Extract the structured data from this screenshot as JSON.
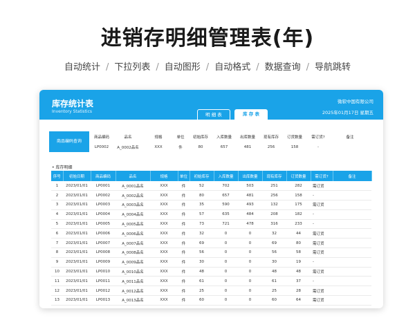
{
  "title": "进销存明细管理表(年)",
  "features": [
    "自动统计",
    "下拉列表",
    "自动图形",
    "自动格式",
    "数据查询",
    "导航跳转"
  ],
  "panel": {
    "title": "库存统计表",
    "subtitle": "Inventory Statistics",
    "company": "微软中国有限公司",
    "date": "2025年01月17日  星期五",
    "tabs": [
      {
        "label": "明 细 表",
        "active": false
      },
      {
        "label": "库 存 表",
        "active": true
      }
    ]
  },
  "query": {
    "button_label": "商品编码查询",
    "headers": [
      "商品编码",
      "品名",
      "规格",
      "单位",
      "初始库存",
      "入库数量",
      "出库数量",
      "现有库存",
      "订货数量",
      "需订货?",
      "备注"
    ],
    "row": [
      "LP0002",
      "A_0002品名",
      "XXX",
      "件",
      "80",
      "657",
      "481",
      "256",
      "158",
      "-",
      ""
    ]
  },
  "section_label": "• 库存明细",
  "table": {
    "headers": [
      "序号",
      "初始日期",
      "商品编码",
      "品名",
      "规格",
      "单位",
      "初始库存",
      "入库数量",
      "出库数量",
      "现有库存",
      "订货数量",
      "需订货?",
      "备注"
    ],
    "rows": [
      [
        "1",
        "2023/01/01",
        "LP0001",
        "A_0001品名",
        "XXX",
        "件",
        "52",
        "702",
        "503",
        "251",
        "282",
        "需订货",
        ""
      ],
      [
        "2",
        "2023/01/01",
        "LP0002",
        "A_0002品名",
        "XXX",
        "件",
        "80",
        "657",
        "481",
        "256",
        "158",
        "-",
        ""
      ],
      [
        "3",
        "2023/01/01",
        "LP0003",
        "A_0003品名",
        "XXX",
        "件",
        "35",
        "590",
        "493",
        "132",
        "175",
        "需订货",
        ""
      ],
      [
        "4",
        "2023/01/01",
        "LP0004",
        "A_0004品名",
        "XXX",
        "件",
        "57",
        "635",
        "484",
        "208",
        "182",
        "-",
        ""
      ],
      [
        "5",
        "2023/01/01",
        "LP0005",
        "A_0005品名",
        "XXX",
        "件",
        "73",
        "721",
        "478",
        "316",
        "233",
        "-",
        ""
      ],
      [
        "6",
        "2023/01/01",
        "LP0006",
        "A_0006品名",
        "XXX",
        "件",
        "32",
        "0",
        "0",
        "32",
        "44",
        "需订货",
        ""
      ],
      [
        "7",
        "2023/01/01",
        "LP0007",
        "A_0007品名",
        "XXX",
        "件",
        "69",
        "0",
        "0",
        "69",
        "80",
        "需订货",
        ""
      ],
      [
        "8",
        "2023/01/01",
        "LP0008",
        "A_0008品名",
        "XXX",
        "件",
        "56",
        "0",
        "0",
        "56",
        "58",
        "需订货",
        ""
      ],
      [
        "9",
        "2023/01/01",
        "LP0009",
        "A_0009品名",
        "XXX",
        "件",
        "30",
        "0",
        "0",
        "30",
        "19",
        "-",
        ""
      ],
      [
        "10",
        "2023/01/01",
        "LP0010",
        "A_0010品名",
        "XXX",
        "件",
        "48",
        "0",
        "0",
        "48",
        "48",
        "需订货",
        ""
      ],
      [
        "11",
        "2023/01/01",
        "LP0011",
        "A_0011品名",
        "XXX",
        "件",
        "61",
        "0",
        "0",
        "61",
        "37",
        "-",
        ""
      ],
      [
        "12",
        "2023/01/01",
        "LP0012",
        "A_0012品名",
        "XXX",
        "件",
        "25",
        "0",
        "0",
        "25",
        "28",
        "需订货",
        ""
      ],
      [
        "13",
        "2023/01/01",
        "LP0013",
        "A_0013品名",
        "XXX",
        "件",
        "60",
        "0",
        "0",
        "60",
        "64",
        "需订货",
        ""
      ]
    ]
  }
}
